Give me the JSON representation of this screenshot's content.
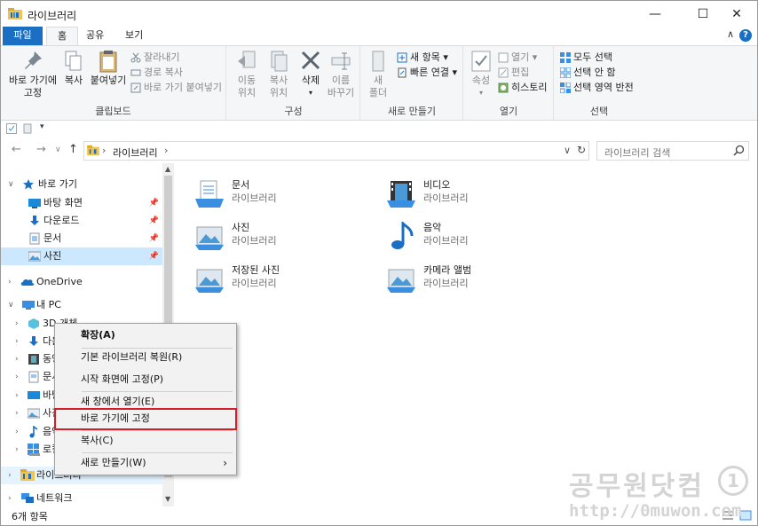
{
  "window": {
    "title": "라이브러리",
    "minimize": "—",
    "maximize": "☐",
    "close": "✕"
  },
  "tabs": [
    {
      "label": "파일"
    },
    {
      "label": "홈"
    },
    {
      "label": "공유"
    },
    {
      "label": "보기"
    }
  ],
  "ribbon": {
    "clipboard": {
      "label": "클립보드",
      "pin": "바로 가기에\n고정",
      "copy": "복사",
      "paste": "붙여넣기",
      "cut": "잘라내기",
      "copy_path": "경로 복사",
      "paste_shortcut": "바로 가기 붙여넣기"
    },
    "organize": {
      "label": "구성",
      "move_to": "이동\n위치",
      "copy_to": "복사\n위치",
      "delete": "삭제",
      "rename": "이름\n바꾸기"
    },
    "new": {
      "label": "새로 만들기",
      "new_folder": "새\n폴더",
      "new_item": "새 항목",
      "easy_access": "빠른 연결"
    },
    "open": {
      "label": "열기",
      "properties": "속성",
      "open": "열기",
      "edit": "편집",
      "history": "히스토리"
    },
    "select": {
      "label": "선택",
      "select_all": "모두 선택",
      "select_none": "선택 안 함",
      "invert": "선택 영역 반전"
    }
  },
  "address": {
    "crumb": "라이브러리",
    "search_placeholder": "라이브러리 검색"
  },
  "nav": {
    "quick_access": "바로 가기",
    "quick_items": [
      "바탕 화면",
      "다운로드",
      "문서",
      "사진"
    ],
    "onedrive": "OneDrive",
    "this_pc": "내 PC",
    "pc_items": [
      "3D 개체",
      "다운로드",
      "동영상",
      "문서",
      "바탕 화면",
      "사진",
      "음악",
      "로컬 디스크"
    ],
    "libraries": "라이브러리",
    "network": "네트워크"
  },
  "libraries": [
    {
      "name": "문서",
      "type": "라이브러리"
    },
    {
      "name": "비디오",
      "type": "라이브러리"
    },
    {
      "name": "사진",
      "type": "라이브러리"
    },
    {
      "name": "음악",
      "type": "라이브러리"
    },
    {
      "name": "저장된 사진",
      "type": "라이브러리"
    },
    {
      "name": "카메라 앨범",
      "type": "라이브러리"
    }
  ],
  "context_menu": {
    "expand": "확장(A)",
    "restore": "기본 라이브러리 복원(R)",
    "pin_start": "시작 화면에 고정(P)",
    "open_new": "새 창에서 열기(E)",
    "pin_quick": "바로 가기에 고정",
    "copy": "복사(C)",
    "new": "새로 만들기(W)"
  },
  "status": {
    "count": "6개 항목"
  },
  "watermark": {
    "line1": "공무원닷컴",
    "line2": "http://0muwon.com"
  }
}
